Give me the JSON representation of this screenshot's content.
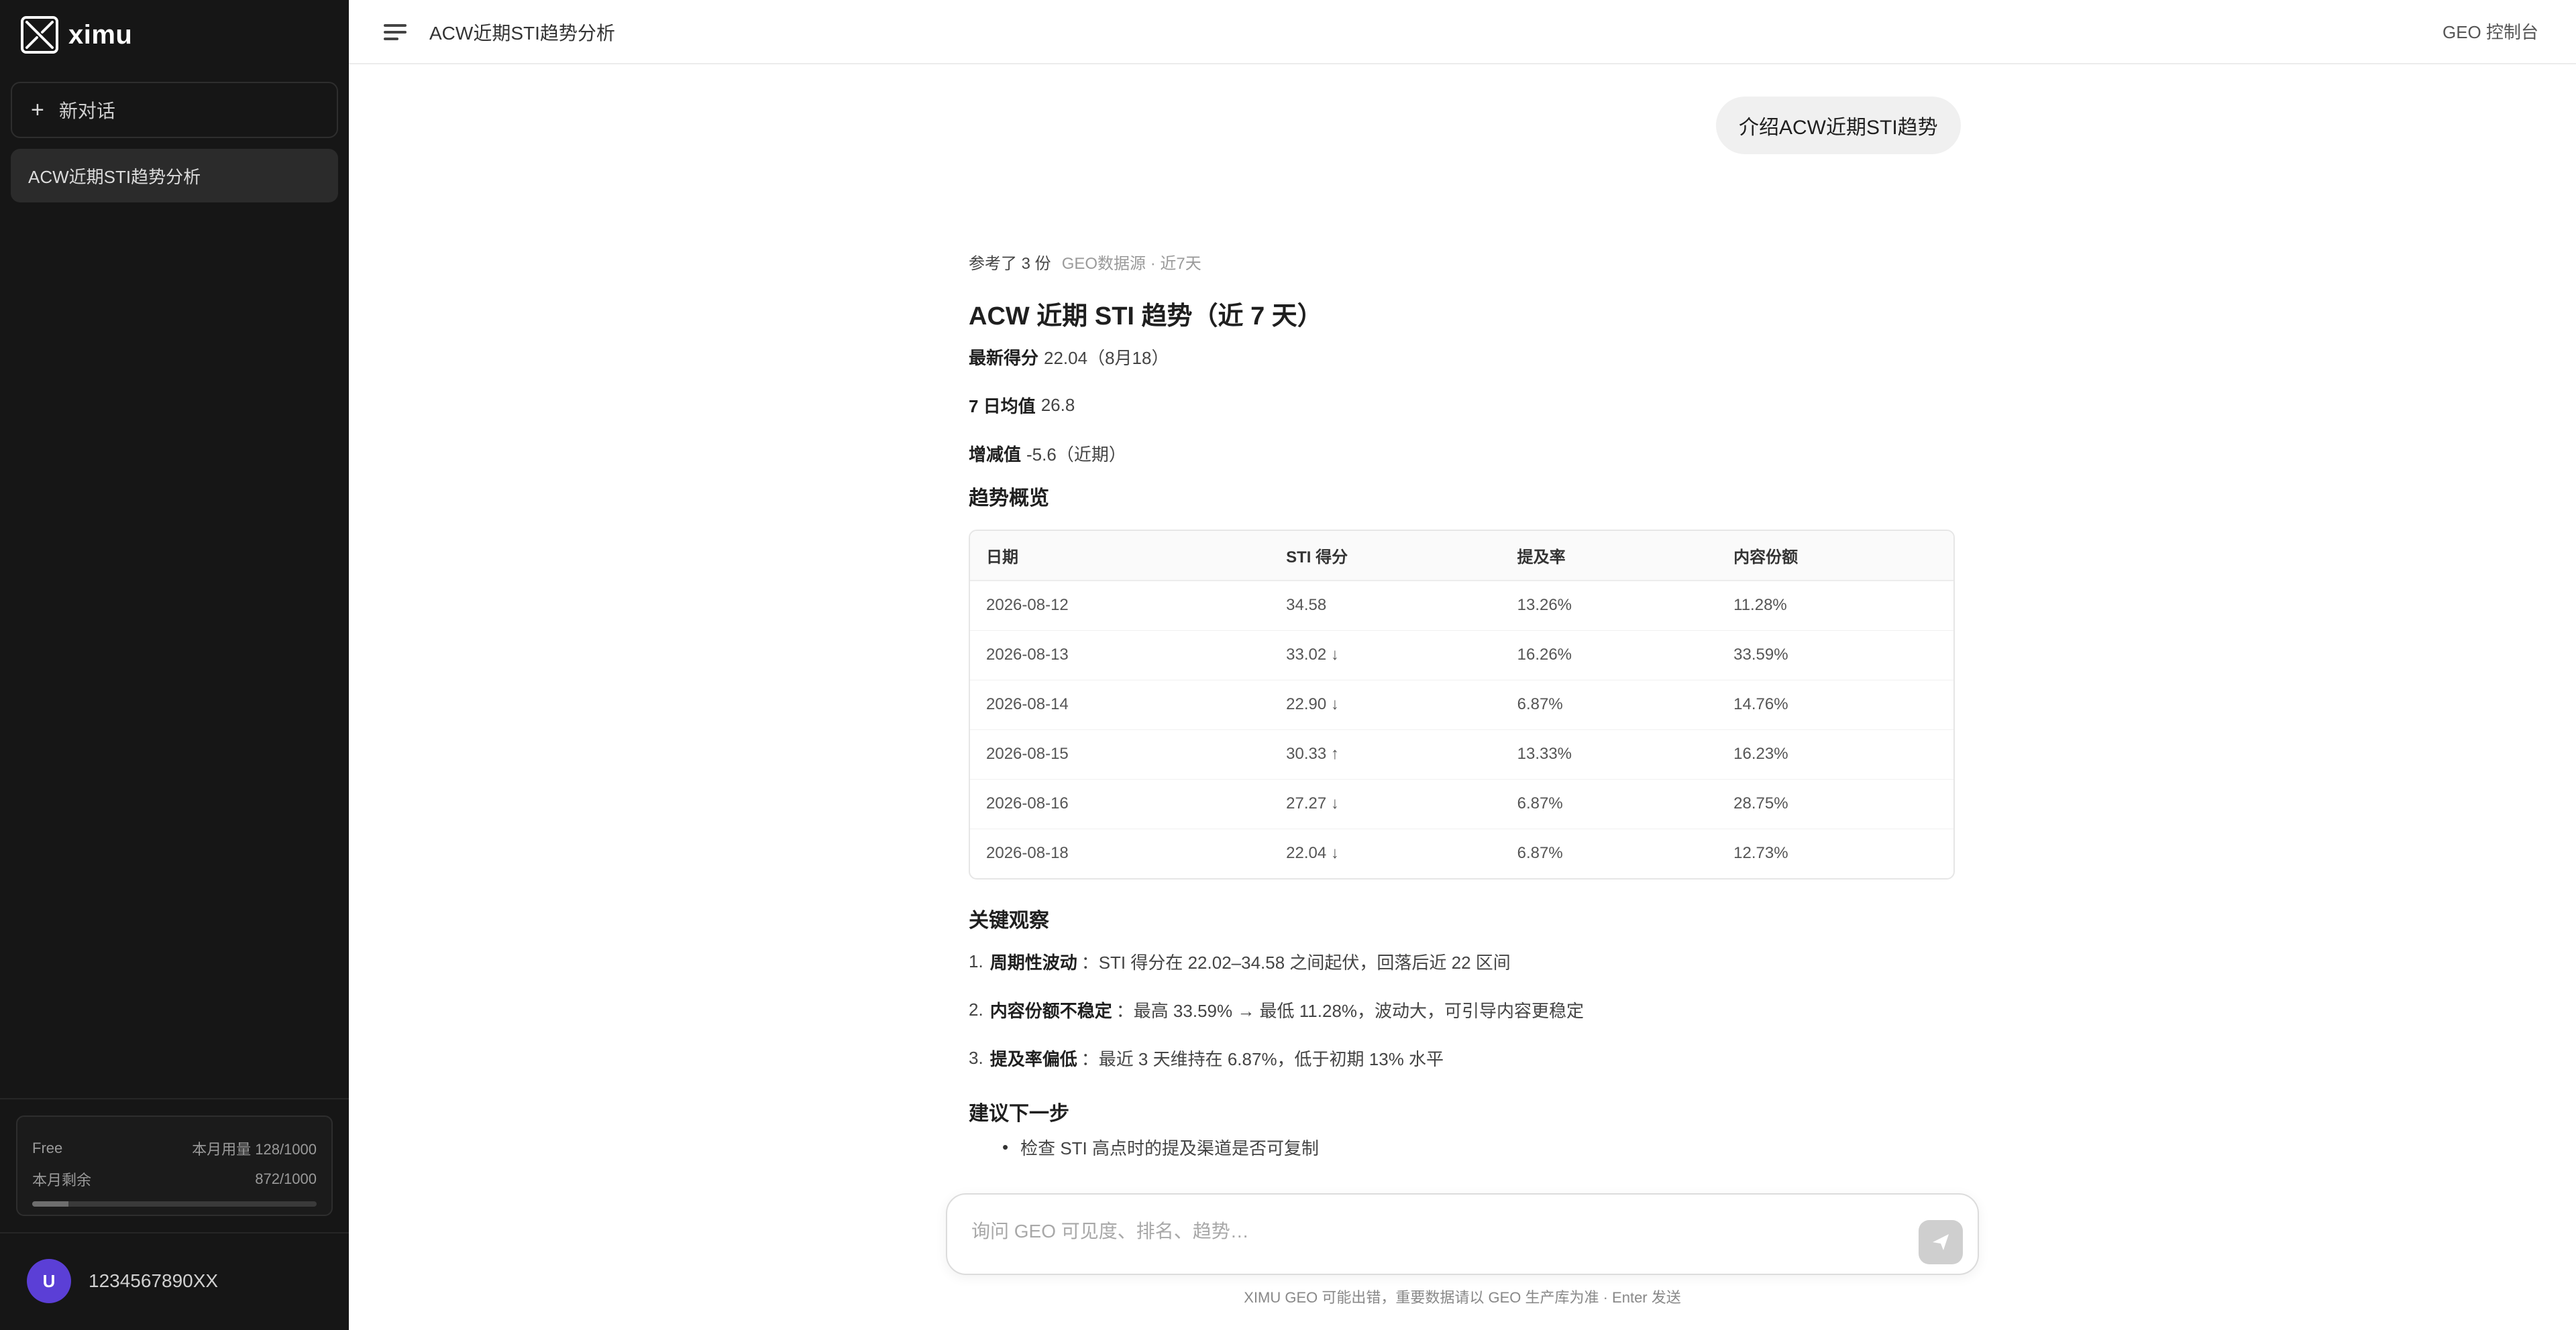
{
  "app": {
    "logo_text": "ximu"
  },
  "sidebar": {
    "new_chat_label": "新对话",
    "conversations": [
      {
        "label": "ACW近期STI趋势分析"
      }
    ],
    "plan": {
      "name": "Free",
      "usage_label": "本月用量 128/1000",
      "quota_label": "本月剩余",
      "quota_value": "872/1000",
      "used_fraction": 0.128
    },
    "user": {
      "avatar_initials": "U",
      "name": "1234567890XX"
    }
  },
  "topbar": {
    "title": "ACW近期STI趋势分析",
    "console_label": "GEO 控制台"
  },
  "chat": {
    "user_message": "介绍ACW近期STI趋势",
    "answer": {
      "ref_prefix": "参考了 3 份",
      "ref_detail": "GEO数据源 · 近7天",
      "title": "ACW 近期 STI 趋势（近 7 天）",
      "kv": [
        {
          "label": "最新得分",
          "value": "22.04（8月18）"
        },
        {
          "label": "7 日均值",
          "value": "26.8"
        },
        {
          "label": "增减值",
          "value": "-5.6（近期）"
        }
      ],
      "trend_title": "趋势概览",
      "table": {
        "headers": [
          "日期",
          "STI 得分",
          "提及率",
          "内容份额"
        ],
        "rows": [
          [
            "2026-08-12",
            "34.58",
            "13.26%",
            "11.28%"
          ],
          [
            "2026-08-13",
            "33.02 ↓",
            "16.26%",
            "33.59%"
          ],
          [
            "2026-08-14",
            "22.90 ↓",
            "6.87%",
            "14.76%"
          ],
          [
            "2026-08-15",
            "30.33 ↑",
            "13.33%",
            "16.23%"
          ],
          [
            "2026-08-16",
            "27.27 ↓",
            "6.87%",
            "28.75%"
          ],
          [
            "2026-08-18",
            "22.04 ↓",
            "6.87%",
            "12.73%"
          ]
        ]
      },
      "observations_title": "关键观察",
      "observations": [
        {
          "n": "1.",
          "bold": "周期性波动",
          "text": "：STI 得分在 22.02–34.58 之间起伏，回落后近 22 区间"
        },
        {
          "n": "2.",
          "bold": "内容份额不稳定",
          "text": "：最高 33.59% → 最低 11.28%，波动大，可引导内容更稳定"
        },
        {
          "n": "3.",
          "bold": "提及率偏低",
          "text": "：最近 3 天维持在 6.87%，低于初期 13% 水平"
        }
      ],
      "next_title": "建议下一步",
      "next_steps": [
        "检查 STI 高点时的提及渠道是否可复制"
      ]
    }
  },
  "composer": {
    "placeholder": "询问 GEO 可见度、排名、趋势…"
  },
  "footer_note": "XIMU GEO 可能出错，重要数据请以 GEO 生产库为准 · Enter 发送"
}
